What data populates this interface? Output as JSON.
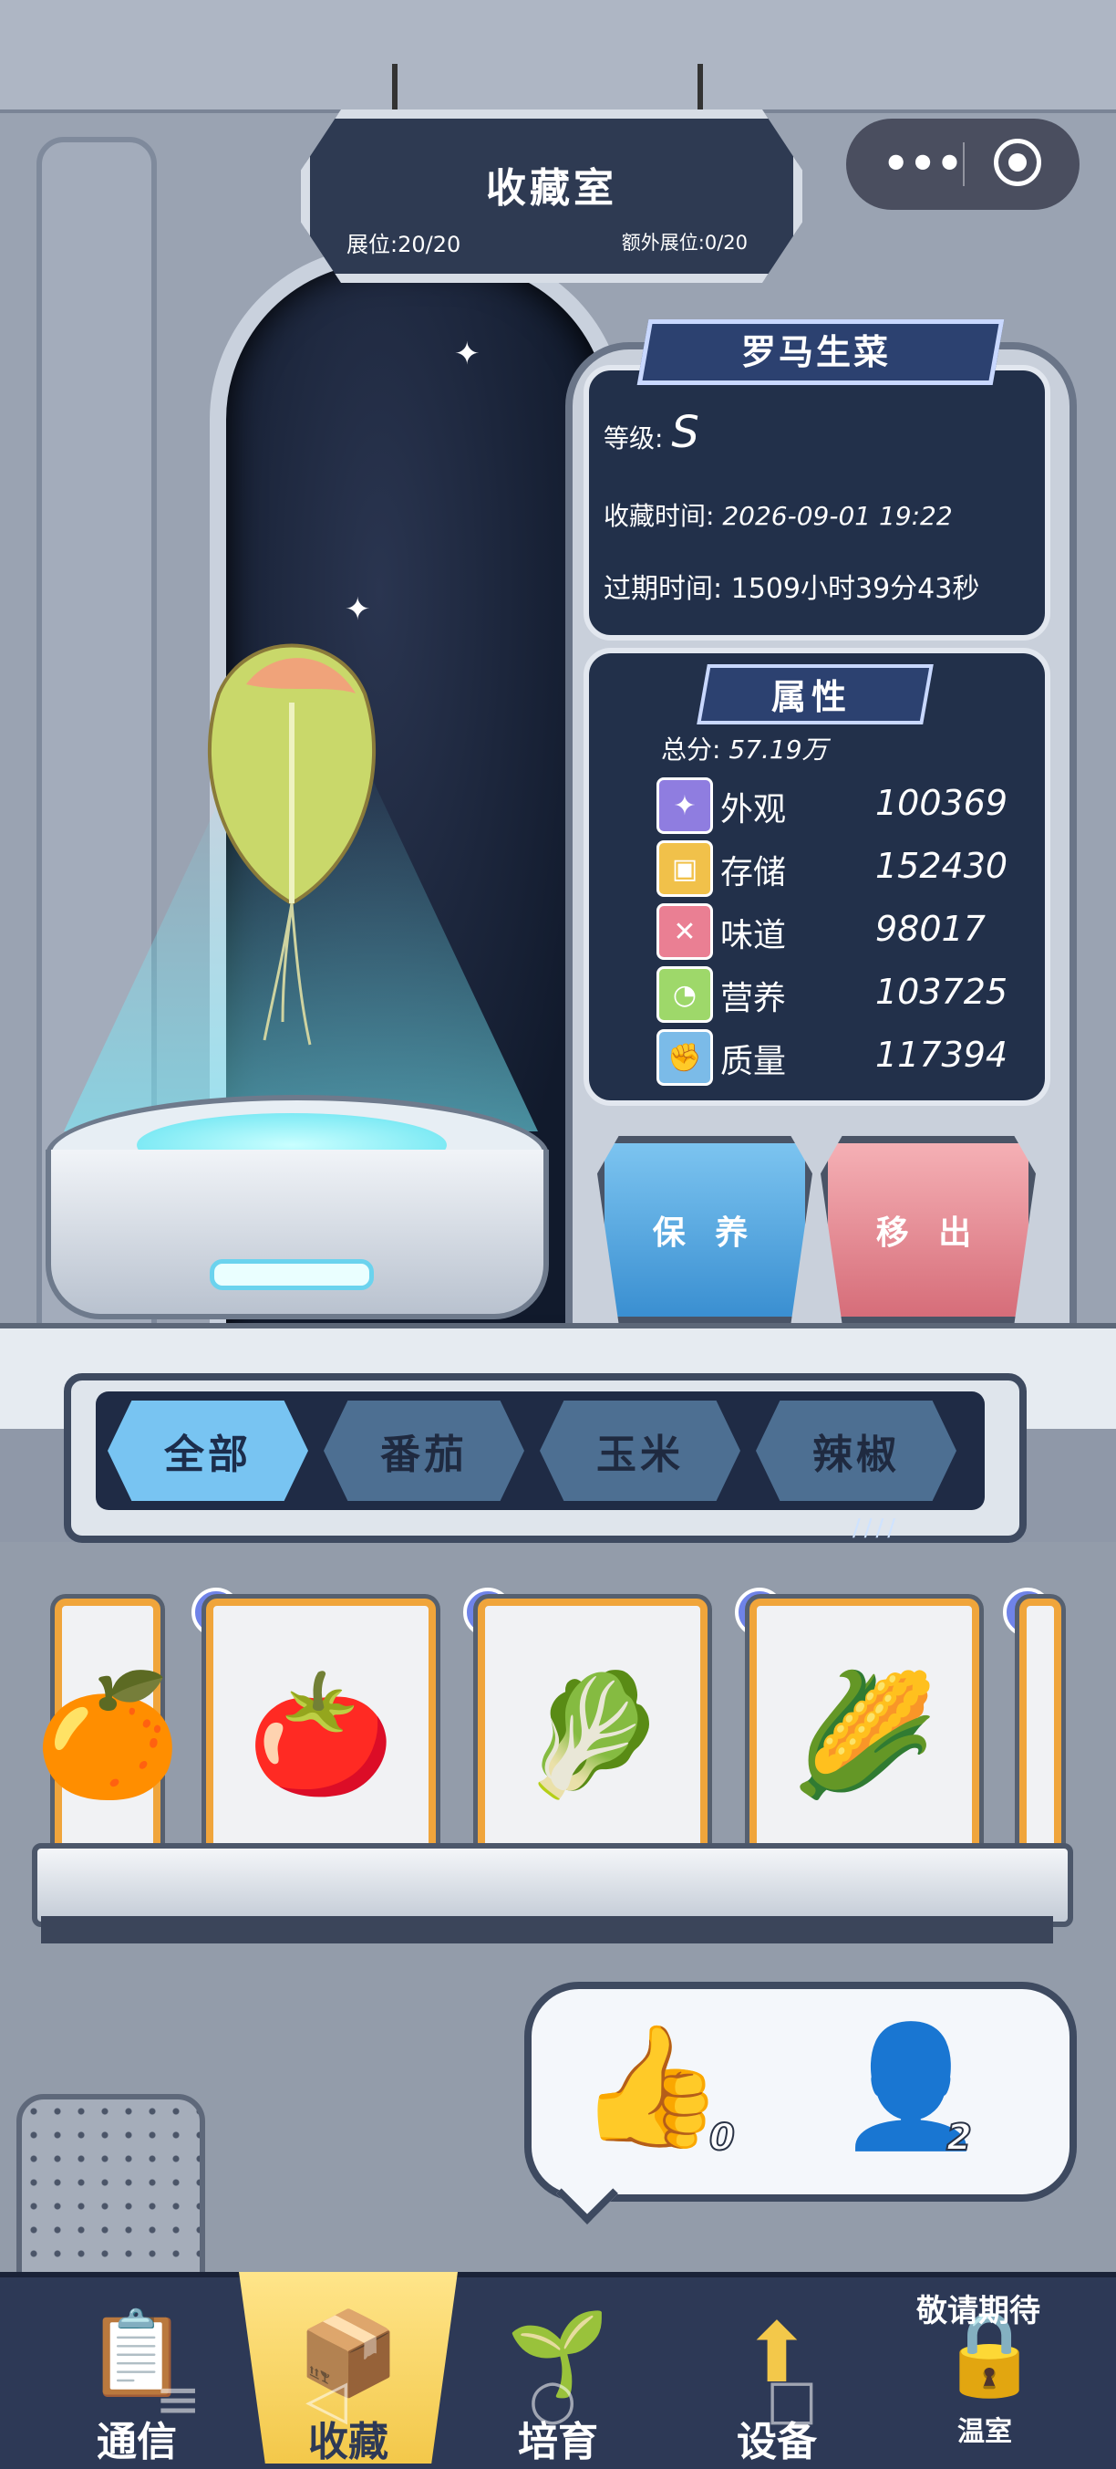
{
  "header": {
    "title": "收藏室",
    "slots": "展位:20/20",
    "extra_slots": "额外展位:0/20"
  },
  "capsule_menu": {
    "more_icon": "more-dots-icon",
    "close_icon": "target-close-icon"
  },
  "item": {
    "name": "罗马生菜",
    "grade_label": "等级:",
    "grade_value": "S",
    "collect_time_label": "收藏时间:",
    "collect_time": "2026-09-01 19:22",
    "expire_time_label": "过期时间:",
    "expire_time": "1509小时39分43秒"
  },
  "attributes": {
    "title": "属性",
    "total_label": "总分:",
    "total_value": "57.19万",
    "rows": [
      {
        "label": "外观",
        "value": "100369",
        "icon": "sparkle-icon",
        "color": "#8f7de0"
      },
      {
        "label": "存储",
        "value": "152430",
        "icon": "box-icon",
        "color": "#f1c14a"
      },
      {
        "label": "味道",
        "value": "98017",
        "icon": "fork-knife-icon",
        "color": "#ea7f93"
      },
      {
        "label": "营养",
        "value": "103725",
        "icon": "lemon-icon",
        "color": "#9ed86a"
      },
      {
        "label": "质量",
        "value": "117394",
        "icon": "muscle-icon",
        "color": "#7bbbe8"
      }
    ]
  },
  "actions": {
    "nurture": "保 养",
    "remove": "移 出"
  },
  "tabs": [
    {
      "label": "全部",
      "active": true
    },
    {
      "label": "番茄",
      "active": false
    },
    {
      "label": "玉米",
      "active": false
    },
    {
      "label": "辣椒",
      "active": false
    }
  ],
  "shelf": [
    {
      "icon": "orange-icon",
      "glyph": "🍊"
    },
    {
      "icon": "tomato-icon",
      "glyph": "🍅"
    },
    {
      "icon": "lettuce-icon",
      "glyph": "🥬"
    },
    {
      "icon": "corn-icon",
      "glyph": "🌽"
    }
  ],
  "social": {
    "likes": "0",
    "visitors": "2"
  },
  "bottom_nav": [
    {
      "label": "通信",
      "icon": "clipboard-icon",
      "glyph": "📋"
    },
    {
      "label": "收藏",
      "icon": "collection-box-icon",
      "glyph": "📦"
    },
    {
      "label": "培育",
      "icon": "sprout-dome-icon",
      "glyph": "🌱"
    },
    {
      "label": "设备",
      "icon": "upgrade-machine-icon",
      "glyph": "⬆"
    },
    {
      "label": "温室",
      "icon": "lock-icon",
      "glyph": "🔒"
    }
  ],
  "coming_soon": "敬请期待"
}
